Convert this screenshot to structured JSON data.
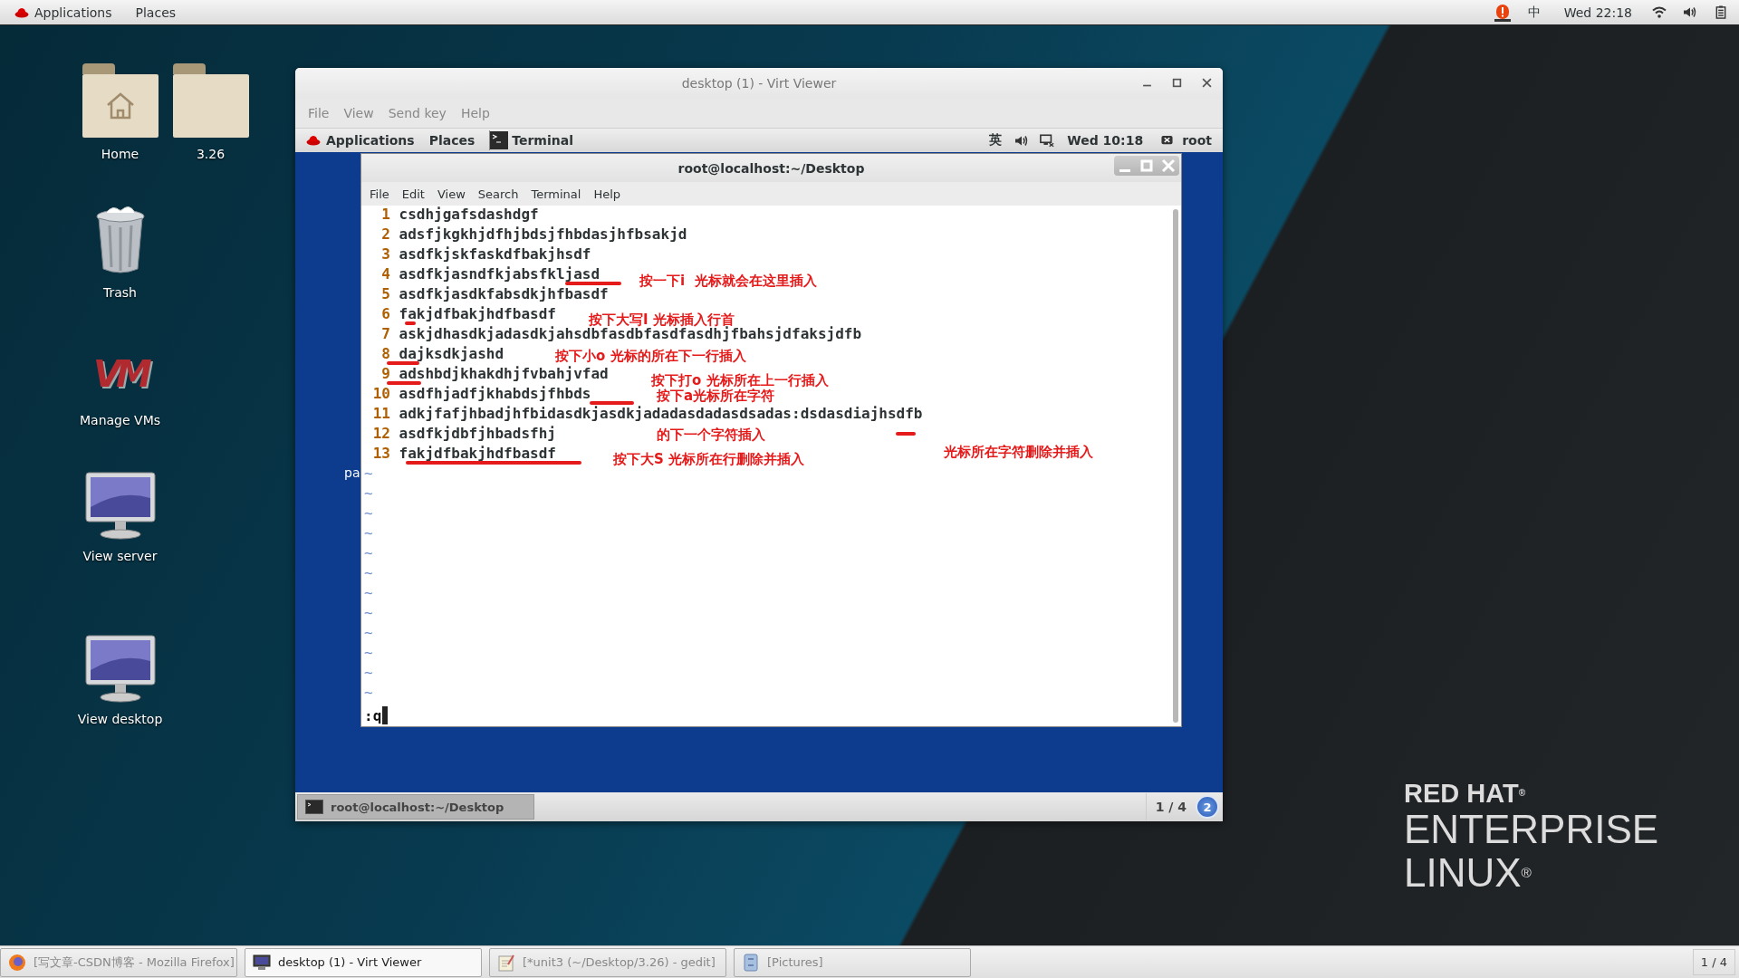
{
  "top_bar": {
    "applications": "Applications",
    "places": "Places",
    "input_method": "中",
    "clock": "Wed 22:18"
  },
  "desktop_icons": [
    {
      "label": "Home",
      "kind": "home"
    },
    {
      "label": "3.26",
      "kind": "folder"
    },
    {
      "label": "Trash",
      "kind": "trash"
    },
    {
      "label": "Manage VMs",
      "kind": "vm",
      "logo": "VM"
    },
    {
      "label": "View server",
      "kind": "monitor"
    },
    {
      "label": "View desktop",
      "kind": "monitor"
    }
  ],
  "virt_viewer": {
    "title": "desktop (1) - Virt Viewer",
    "menu": [
      "File",
      "View",
      "Send key",
      "Help"
    ],
    "guest": {
      "top_bar": {
        "applications": "Applications",
        "places": "Places",
        "task": "Terminal",
        "input_method": "英",
        "clock": "Wed 10:18",
        "user": "root"
      },
      "desktop_label": "pa",
      "terminal": {
        "title": "root@localhost:~/Desktop",
        "menu": [
          "File",
          "Edit",
          "View",
          "Search",
          "Terminal",
          "Help"
        ],
        "lines": [
          {
            "number": "1",
            "text": "csdhjgafsdashdgf"
          },
          {
            "number": "2",
            "text": "adsfjkgkhjdfhjbdsjfhbdasjhfbsakjd"
          },
          {
            "number": "3",
            "text": "asdfkjskfaskdfbakjhsdf"
          },
          {
            "number": "4",
            "text": "asdfkjasndfkjabsfkljasd"
          },
          {
            "number": "5",
            "text": "asdfkjasdkfabsdkjhfbasdf"
          },
          {
            "number": "6",
            "text": "fakjdfbakjhdfbasdf"
          },
          {
            "number": "7",
            "text": "askjdhasdkjadasdkjahsdbfasdbfasdfasdhjfbahsjdfaksjdfb"
          },
          {
            "number": "8",
            "text": "dajksdkjashd"
          },
          {
            "number": "9",
            "text": "adshbdjkhakdhjfvbahjvfad"
          },
          {
            "number": "10",
            "text": "asdfhjadfjkhabdsjfhbds"
          },
          {
            "number": "11",
            "text": "adkjfafjhbadjhfbidasdkjasdkjadadasdadasdsadas:dsdasdiajhsdfb"
          },
          {
            "number": "12",
            "text": "asdfkjdbfjhbadsfhj"
          },
          {
            "number": "13",
            "text": "fakjdfbakjhdfbasdf"
          }
        ],
        "tildes": [
          "~",
          "~",
          "~",
          "~",
          "~",
          "~",
          "~",
          "~",
          "~",
          "~",
          "~",
          "~"
        ],
        "command": ":q"
      },
      "annotations": [
        "按一下i  光标就会在这里插入",
        "按下大写I 光标插入行首",
        "按下小o 光标的所在下一行插入",
        "按下打o 光标所在上一行插入",
        "按下a光标所在字符",
        "的下一个字符插入",
        "按下大S 光标所在行删除并插入",
        "光标所在字符删除并插入"
      ],
      "bottom_bar": {
        "task": "root@localhost:~/Desktop",
        "workspace": "1 / 4",
        "badge": "2"
      }
    }
  },
  "logo": {
    "line_1": "RED HAT$^{®}$",
    "line_2": "ENTERPRISE",
    "line_3": "LINUX$^{®}$"
  },
  "taskbar": [
    {
      "label": "[写文章-CSDN博客 - Mozilla Firefox]",
      "kind": "browser",
      "selected": false
    },
    {
      "label": "desktop (1) - Virt Viewer",
      "kind": "monitor",
      "selected": true
    },
    {
      "label": "[*unit3 (~/Desktop/3.26) - gedit]",
      "kind": "editor",
      "selected": false
    },
    {
      "label": "[Pictures]",
      "kind": "files",
      "selected": false
    }
  ],
  "workspace": "1 / 4"
}
